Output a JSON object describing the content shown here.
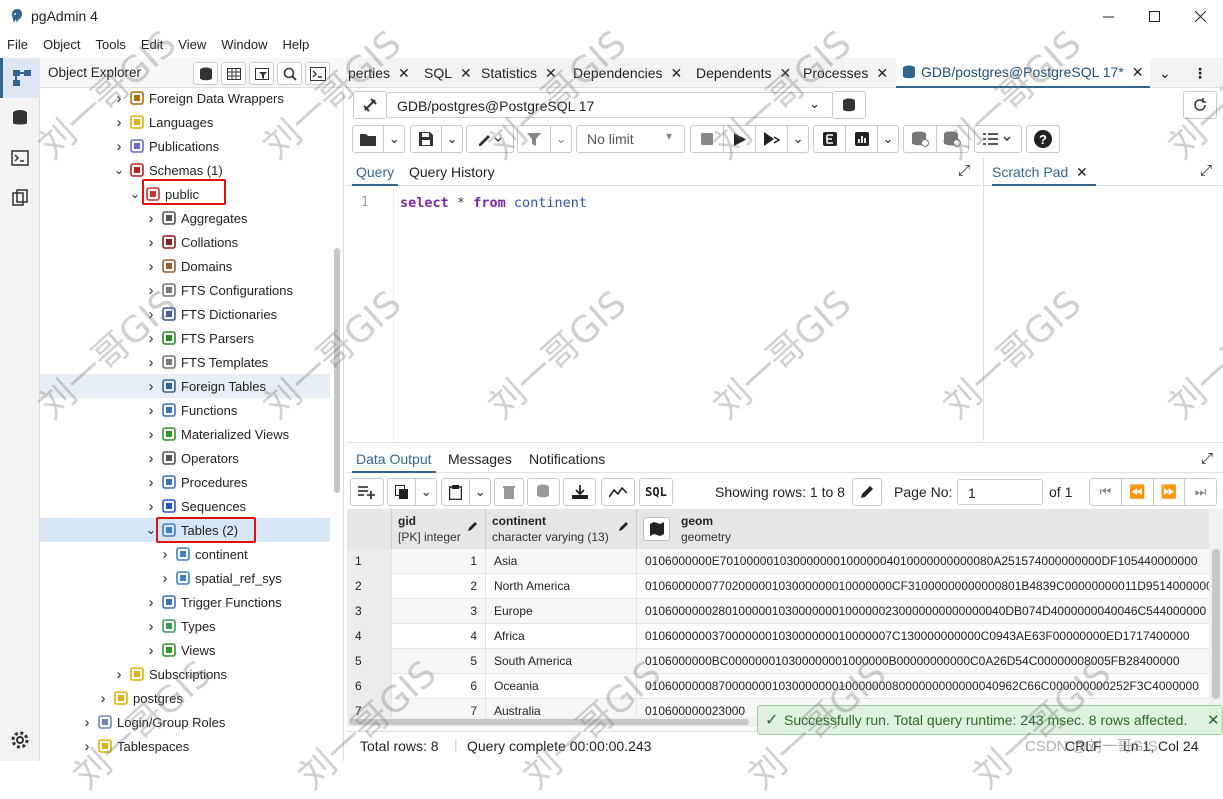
{
  "app": {
    "title": "pgAdmin 4"
  },
  "menu": [
    "File",
    "Object",
    "Tools",
    "Edit",
    "View",
    "Window",
    "Help"
  ],
  "object_explorer": {
    "title": "Object Explorer",
    "tree": [
      {
        "label": "Foreign Data Wrappers",
        "level": 1,
        "icon": "foreign-data-wrapper-icon"
      },
      {
        "label": "Languages",
        "level": 1,
        "icon": "language-icon"
      },
      {
        "label": "Publications",
        "level": 1,
        "icon": "publication-icon"
      },
      {
        "label": "Schemas (1)",
        "level": 1,
        "icon": "schema-icon",
        "expanded": true
      },
      {
        "label": "public",
        "level": 2,
        "icon": "schema-public-icon",
        "expanded": true,
        "highlighted_box": true
      },
      {
        "label": "Aggregates",
        "level": 3,
        "icon": "aggregate-icon"
      },
      {
        "label": "Collations",
        "level": 3,
        "icon": "collation-icon"
      },
      {
        "label": "Domains",
        "level": 3,
        "icon": "domain-icon"
      },
      {
        "label": "FTS Configurations",
        "level": 3,
        "icon": "fts-config-icon"
      },
      {
        "label": "FTS Dictionaries",
        "level": 3,
        "icon": "fts-dictionary-icon"
      },
      {
        "label": "FTS Parsers",
        "level": 3,
        "icon": "fts-parser-icon"
      },
      {
        "label": "FTS Templates",
        "level": 3,
        "icon": "fts-template-icon"
      },
      {
        "label": "Foreign Tables",
        "level": 3,
        "icon": "foreign-table-icon",
        "hover": true
      },
      {
        "label": "Functions",
        "level": 3,
        "icon": "function-icon"
      },
      {
        "label": "Materialized Views",
        "level": 3,
        "icon": "materialized-view-icon"
      },
      {
        "label": "Operators",
        "level": 3,
        "icon": "operator-icon"
      },
      {
        "label": "Procedures",
        "level": 3,
        "icon": "procedure-icon"
      },
      {
        "label": "Sequences",
        "level": 3,
        "icon": "sequence-icon"
      },
      {
        "label": "Tables (2)",
        "level": 3,
        "icon": "tables-icon",
        "expanded": true,
        "selected": true,
        "highlighted_box": true
      },
      {
        "label": "continent",
        "level": 4,
        "icon": "table-icon"
      },
      {
        "label": "spatial_ref_sys",
        "level": 4,
        "icon": "table-icon"
      },
      {
        "label": "Trigger Functions",
        "level": 3,
        "icon": "trigger-function-icon"
      },
      {
        "label": "Types",
        "level": 3,
        "icon": "type-icon"
      },
      {
        "label": "Views",
        "level": 3,
        "icon": "view-icon"
      },
      {
        "label": "Subscriptions",
        "level": 1,
        "icon": "subscription-icon"
      },
      {
        "label": "postgres",
        "level": 0,
        "icon": "database-icon"
      },
      {
        "label": "Login/Group Roles",
        "level": -1,
        "icon": "login-role-icon"
      },
      {
        "label": "Tablespaces",
        "level": -1,
        "icon": "tablespace-icon"
      }
    ]
  },
  "tabs": [
    {
      "label": "perties"
    },
    {
      "label": "SQL"
    },
    {
      "label": "Statistics"
    },
    {
      "label": "Dependencies"
    },
    {
      "label": "Dependents"
    },
    {
      "label": "Processes"
    },
    {
      "label": "GDB/postgres@PostgreSQL 17*",
      "active": true
    }
  ],
  "query_tool": {
    "connection": "GDB/postgres@PostgreSQL 17",
    "limit": "No limit",
    "editor_tabs": [
      "Query",
      "Query History"
    ],
    "scratch_pad": "Scratch Pad",
    "line_no": "1",
    "sql": {
      "kw1": "select",
      "star": "*",
      "kw2": "from",
      "table": "continent"
    }
  },
  "output": {
    "tabs": [
      "Data Output",
      "Messages",
      "Notifications"
    ],
    "sql_btn": "SQL",
    "showing_rows": "Showing rows: 1 to 8",
    "page_no_label": "Page No:",
    "page_no": "1",
    "of_pages": "of 1",
    "columns": [
      {
        "name": "gid",
        "type": "[PK] integer"
      },
      {
        "name": "continent",
        "type": "character varying (13)"
      },
      {
        "name": "geom",
        "type": "geometry"
      }
    ],
    "rows": [
      {
        "n": "1",
        "gid": "1",
        "continent": "Asia",
        "geom": "0106000000E70100000103000000010000004010000000000080A251574000000000DF105440000000"
      },
      {
        "n": "2",
        "gid": "2",
        "continent": "North America",
        "geom": "0106000000770200000103000000010000000CF31000000000000801B4839C00000000011D9514000000"
      },
      {
        "n": "3",
        "gid": "3",
        "continent": "Europe",
        "geom": "010600000028010000010300000001000000230000000000000040DB074D4000000040046C544000000"
      },
      {
        "n": "4",
        "gid": "4",
        "continent": "Africa",
        "geom": "0106000000370000000103000000010000007C130000000000C0943AE63F00000000ED1717400000"
      },
      {
        "n": "5",
        "gid": "5",
        "continent": "South America",
        "geom": "0106000000BC000000010300000001000000B00000000000C0A26D54C00000008005FB28400000"
      },
      {
        "n": "6",
        "gid": "6",
        "continent": "Oceania",
        "geom": "01060000008700000001030000000100000008000000000000040962C66C000000000252F3C4000000"
      },
      {
        "n": "7",
        "gid": "7",
        "continent": "Australia",
        "geom": "010600000023000"
      }
    ],
    "total_rows": "Total rows: 8",
    "query_complete": "Query complete 00:00:00.243",
    "toast": "Successfully run. Total query runtime: 243 msec. 8 rows affected.",
    "crlf": "CRLF",
    "ln_col": "Ln 1, Col 24"
  },
  "watermark": "刘一哥GIS",
  "csdn": "CSDN @刘一哥GIS",
  "colors": {
    "accent": "#326690",
    "highlight_box": "#e21010",
    "toast_bg": "#dff1df"
  }
}
